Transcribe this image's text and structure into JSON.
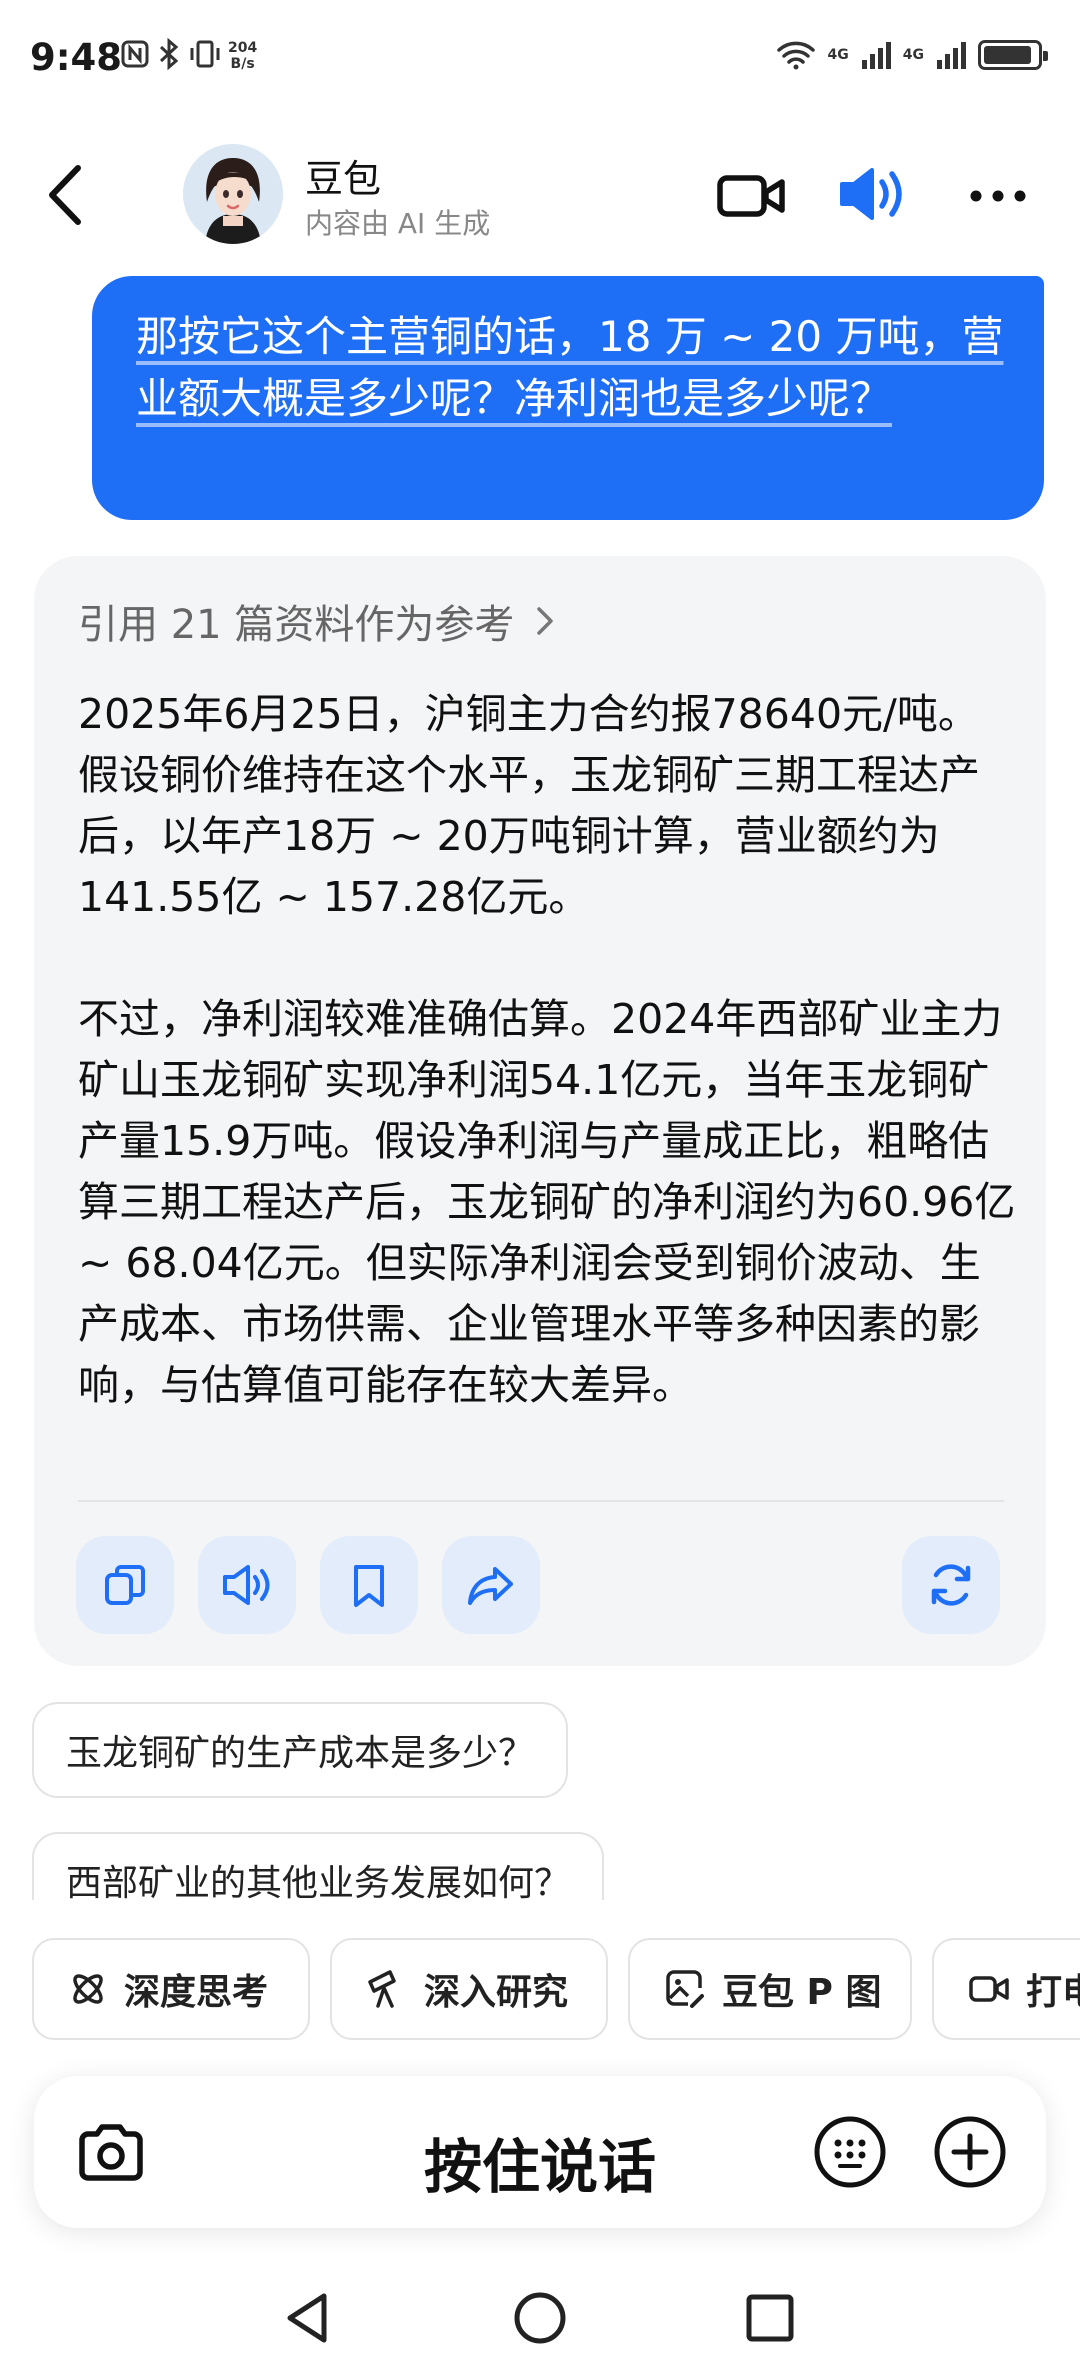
{
  "status_bar": {
    "time": "9:48",
    "speed_value": "204",
    "speed_unit": "B/s",
    "net1": "4G",
    "net2": "4G",
    "battery_level": 0.9
  },
  "header": {
    "name": "豆包",
    "subtitle": "内容由 AI 生成"
  },
  "user_message": {
    "text": "那按它这个主营铜的话，18 万 ~ 20 万吨，营业额大概是多少呢？净利润也是多少呢？"
  },
  "ai_message": {
    "references_label": "引用 21 篇资料作为参考",
    "paragraph1": "2025年6月25日，沪铜主力合约报78640元/吨。假设铜价维持在这个水平，玉龙铜矿三期工程达产后，以年产18万 ~ 20万吨铜计算，营业额约为141.55亿 ~ 157.28亿元。",
    "paragraph2": "不过，净利润较难准确估算。2024年西部矿业主力矿山玉龙铜矿实现净利润54.1亿元，当年玉龙铜矿产量15.9万吨。假设净利润与产量成正比，粗略估算三期工程达产后，玉龙铜矿的净利润约为60.96亿 ~ 68.04亿元。但实际净利润会受到铜价波动、生产成本、市场供需、企业管理水平等多种因素的影响，与估算值可能存在较大差异。"
  },
  "suggestions": [
    "玉龙铜矿的生产成本是多少？",
    "西部矿业的其他业务发展如何？"
  ],
  "skills": [
    {
      "label": "深度思考",
      "icon": "atom-icon"
    },
    {
      "label": "深入研究",
      "icon": "telescope-icon"
    },
    {
      "label": "豆包 P 图",
      "icon": "image-edit-icon"
    },
    {
      "label": "打电话",
      "icon": "video-call-icon"
    }
  ],
  "input": {
    "hold_to_talk": "按住说话"
  },
  "colors": {
    "accent": "#1f6ff6",
    "action_bg": "#e3ecfa",
    "card_bg": "#f4f5f7"
  }
}
